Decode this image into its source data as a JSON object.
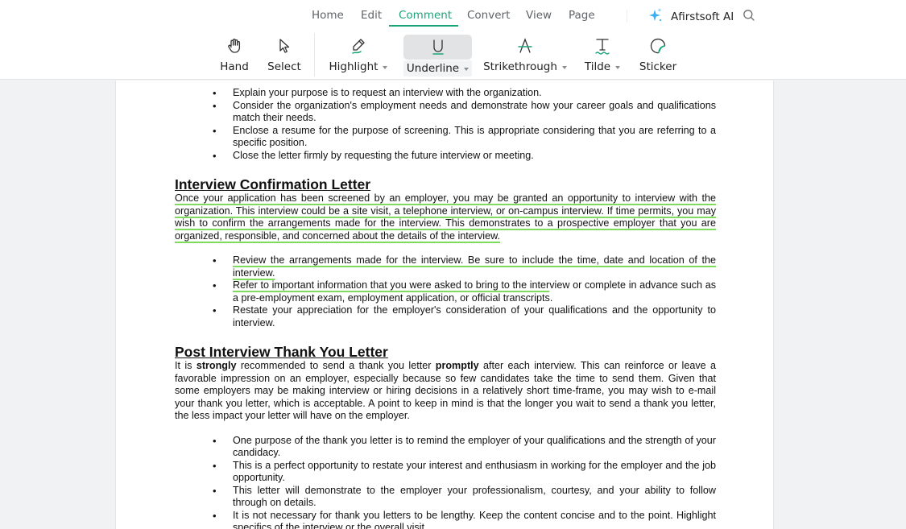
{
  "menu": {
    "tabs": [
      {
        "label": "Home",
        "active": false
      },
      {
        "label": "Edit",
        "active": false
      },
      {
        "label": "Comment",
        "active": true
      },
      {
        "label": "Convert",
        "active": false
      },
      {
        "label": "View",
        "active": false
      },
      {
        "label": "Page",
        "active": false
      }
    ],
    "ai_label": "Afirstsoft AI",
    "search_icon": "search-icon",
    "accent_color": "#1aa37a"
  },
  "toolbar": {
    "tools": [
      {
        "label": "Hand",
        "icon": "hand-icon",
        "dropdown": false
      },
      {
        "label": "Select",
        "icon": "cursor-icon",
        "dropdown": false
      },
      {
        "label": "Highlight",
        "icon": "highlighter-pen-icon",
        "dropdown": true
      },
      {
        "label": "Underline",
        "icon": "underline-icon",
        "dropdown": true,
        "selected": true
      },
      {
        "label": "Strikethrough",
        "icon": "strikethrough-icon",
        "dropdown": true
      },
      {
        "label": "Tilde",
        "icon": "tilde-text-icon",
        "dropdown": true
      },
      {
        "label": "Sticker",
        "icon": "sticker-icon",
        "dropdown": false
      }
    ]
  },
  "document": {
    "intro_bullets": [
      "Explain your purpose is to request an interview with the organization.",
      "Consider the organization's employment needs and demonstrate how your career goals and qualifications match their needs.",
      "Enclose a resume for the purpose of screening.  This is appropriate considering that you are referring to a specific position.",
      "Close the letter firmly by requesting the future interview or meeting."
    ],
    "section1": {
      "heading": "Interview Confirmation Letter",
      "paragraph": "Once your application has been screened by an employer, you may be granted an opportunity to interview with the organization.  This interview could be a site visit, a telephone interview, or on-campus interview.  If time permits, you may wish to confirm the arrangements made for the interview.  This demonstrates to a prospective employer that you are organized, responsible, and concerned about the details of the interview.",
      "bullets": {
        "b1": "Review the arrangements made for the interview.  Be sure to include the time, date and location of the interview.",
        "b2_underlined": "Refer to important information that you were asked to bring to the inter",
        "b2_rest": "view or complete in advance such as a pre-employment exam, employment application, or official transcripts.",
        "b3": "Restate your appreciation for the employer's consideration of your qualifications and the opportunity to interview."
      }
    },
    "section2": {
      "heading": "Post Interview Thank You Letter",
      "p_part1": "It is ",
      "p_bold1": "strongly",
      "p_part2": " recommended to send a thank you letter ",
      "p_bold2": "promptly",
      "p_part3": " after each interview. This can reinforce or leave a favorable impression on an employer, especially because so few candidates take the time to send them. Given that some employers may be making interview or hiring decisions in a relatively short time-frame, you may wish to e-mail your thank you letter, which is acceptable.  A point to keep in mind is that the longer you wait to send a thank you letter, the less impact your letter will have on the employer.",
      "bullets": [
        "One purpose of the thank you letter is to remind the employer of your qualifications and the strength of your candidacy.",
        "This is a perfect opportunity to restate your interest and enthusiasm in working for the employer and the job opportunity.",
        "This letter will demonstrate to the employer your professionalism, courtesy, and your ability to follow through on details.",
        "It is not necessary for thank you letters to be lengthy. Keep the content concise and to the point. Highlight specifics of the interview or the overall visit."
      ]
    },
    "annotation_color": "#7ddc5e"
  }
}
